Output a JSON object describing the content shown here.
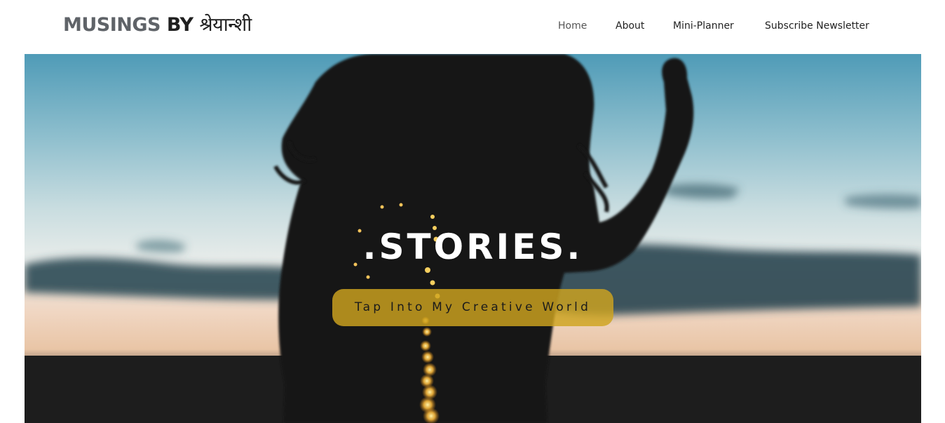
{
  "header": {
    "logo_part1": "MUSINGS ",
    "logo_part2": "BY ",
    "logo_part3": "श्रेयान्शी",
    "nav": [
      {
        "label": "Home"
      },
      {
        "label": "About"
      },
      {
        "label": "Mini-Planner"
      },
      {
        "label": "Subscribe Newsletter"
      }
    ]
  },
  "hero": {
    "title": ".STORIES.",
    "cta_label": "Tap Into My Creative World",
    "image": "silhouette-of-woman-at-sunset-with-fairy-lights"
  },
  "colors": {
    "logo_grey": "#5f6368",
    "logo_dark": "#1f1f1f",
    "cta_gold": "#cea41e",
    "sky_top": "#4f9bb7",
    "sunset": "#e9c5a6"
  }
}
